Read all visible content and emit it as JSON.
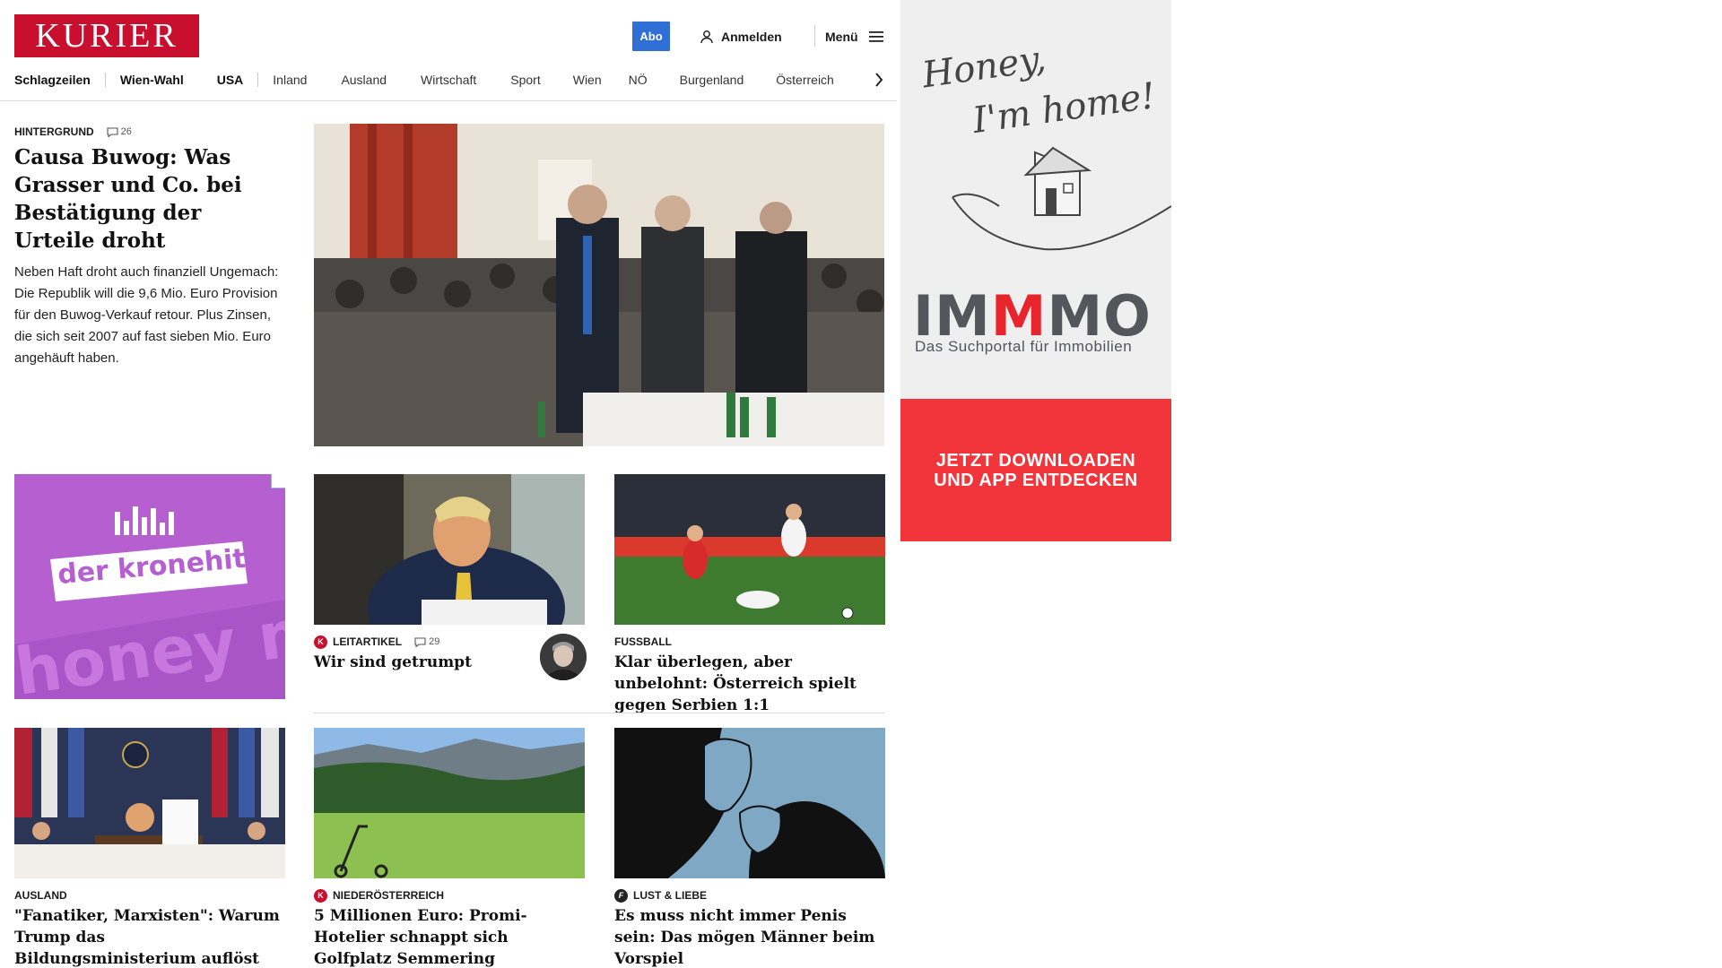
{
  "header": {
    "logo": "KURIER",
    "abo_label": "Abo",
    "login_label": "Anmelden",
    "menu_label": "Menü",
    "brand_color": "#c8102e",
    "abo_color": "#2f6fd6"
  },
  "nav": {
    "items": [
      "Schlagzeilen",
      "Wien-Wahl",
      "USA",
      "Inland",
      "Ausland",
      "Wirtschaft",
      "Sport",
      "Wien",
      "NÖ",
      "Burgenland",
      "Österreich"
    ]
  },
  "hero": {
    "kicker": "HINTERGRUND",
    "comments": "26",
    "title": "Causa Buwog: Was Grasser und Co. bei Bestätigung der Urteile droht",
    "lead": "Neben Haft droht auch finanziell Ungemach: Die Republik will die 9,6 Mio. Euro Provision für den Buwog-Verkauf retour. Plus Zinsen, die sich seit 2007 auf fast sieben Mio. Euro angehäuft haben."
  },
  "ads": {
    "kronehit_logo": "der kronehit",
    "kronehit_bg_text": "honey m",
    "immo_tagline_1": "Honey,",
    "immo_tagline_2": "I'm home!",
    "immo_brand_a": "IM",
    "immo_brand_m": "M",
    "immo_brand_b": "MO",
    "immo_sub": "Das Suchportal für Immobilien",
    "immo_cta_1": "JETZT DOWNLOADEN",
    "immo_cta_2": "UND APP ENTDECKEN"
  },
  "cards": [
    {
      "kicker": "LEITARTIKEL",
      "comments": "29",
      "title": "Wir sind getrumpt",
      "badge": "K"
    },
    {
      "kicker": "FUSSBALL",
      "title": "Klar überlegen, aber unbelohnt: Österreich spielt gegen Serbien 1:1"
    },
    {
      "kicker": "AUSLAND",
      "title": "\"Fanatiker, Marxisten\": Warum Trump das Bildungsministerium auflöst"
    },
    {
      "kicker": "NIEDERÖSTERREICH",
      "title": "5 Millionen Euro: Promi-Hotelier schnappt sich Golfplatz Semmering",
      "badge": "K"
    },
    {
      "kicker": "LUST & LIEBE",
      "title": "Es muss nicht immer Penis sein: Das mögen Männer beim Vorspiel",
      "badge": "f"
    }
  ]
}
